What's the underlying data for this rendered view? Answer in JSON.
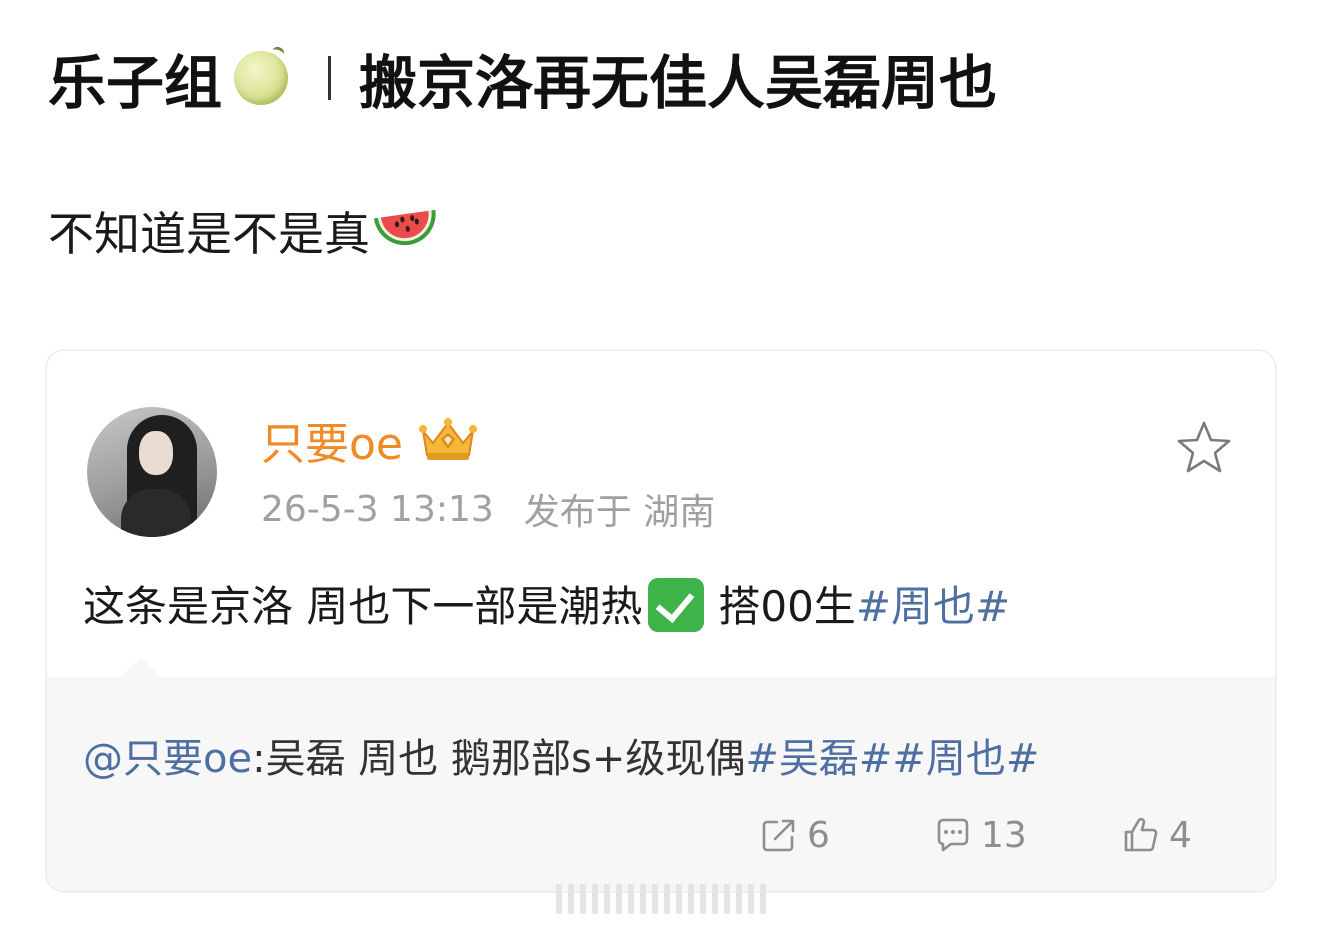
{
  "header": {
    "title_prefix": "乐子组",
    "title_main": "搬京洛再无佳人吴磊周也"
  },
  "subtitle": "不知道是不是真",
  "post": {
    "username": "只要oe",
    "timestamp": "26-5-3 13:13",
    "location": "发布于 湖南",
    "text_before_check": "这条是京洛 周也下一部是潮热",
    "text_after_check": " 搭00生",
    "hashtag": "#周也#",
    "repost": {
      "mention": "@只要oe",
      "text": " :吴磊 周也 鹅那部s+级现偶",
      "hashtags": "#吴磊##周也#"
    },
    "actions": {
      "share_count": "6",
      "comment_count": "13",
      "like_count": "4"
    }
  },
  "colors": {
    "username": "#f08a24",
    "hashtag": "#4f6fa3",
    "meta": "#a0a0a0",
    "repost_bg": "#f7f7f7"
  },
  "icons": [
    "melon-emoji-icon",
    "watermelon-emoji-icon",
    "crown-badge-icon",
    "star-favorite-icon",
    "check-mark-emoji-icon",
    "share-icon",
    "comment-icon",
    "like-icon"
  ]
}
